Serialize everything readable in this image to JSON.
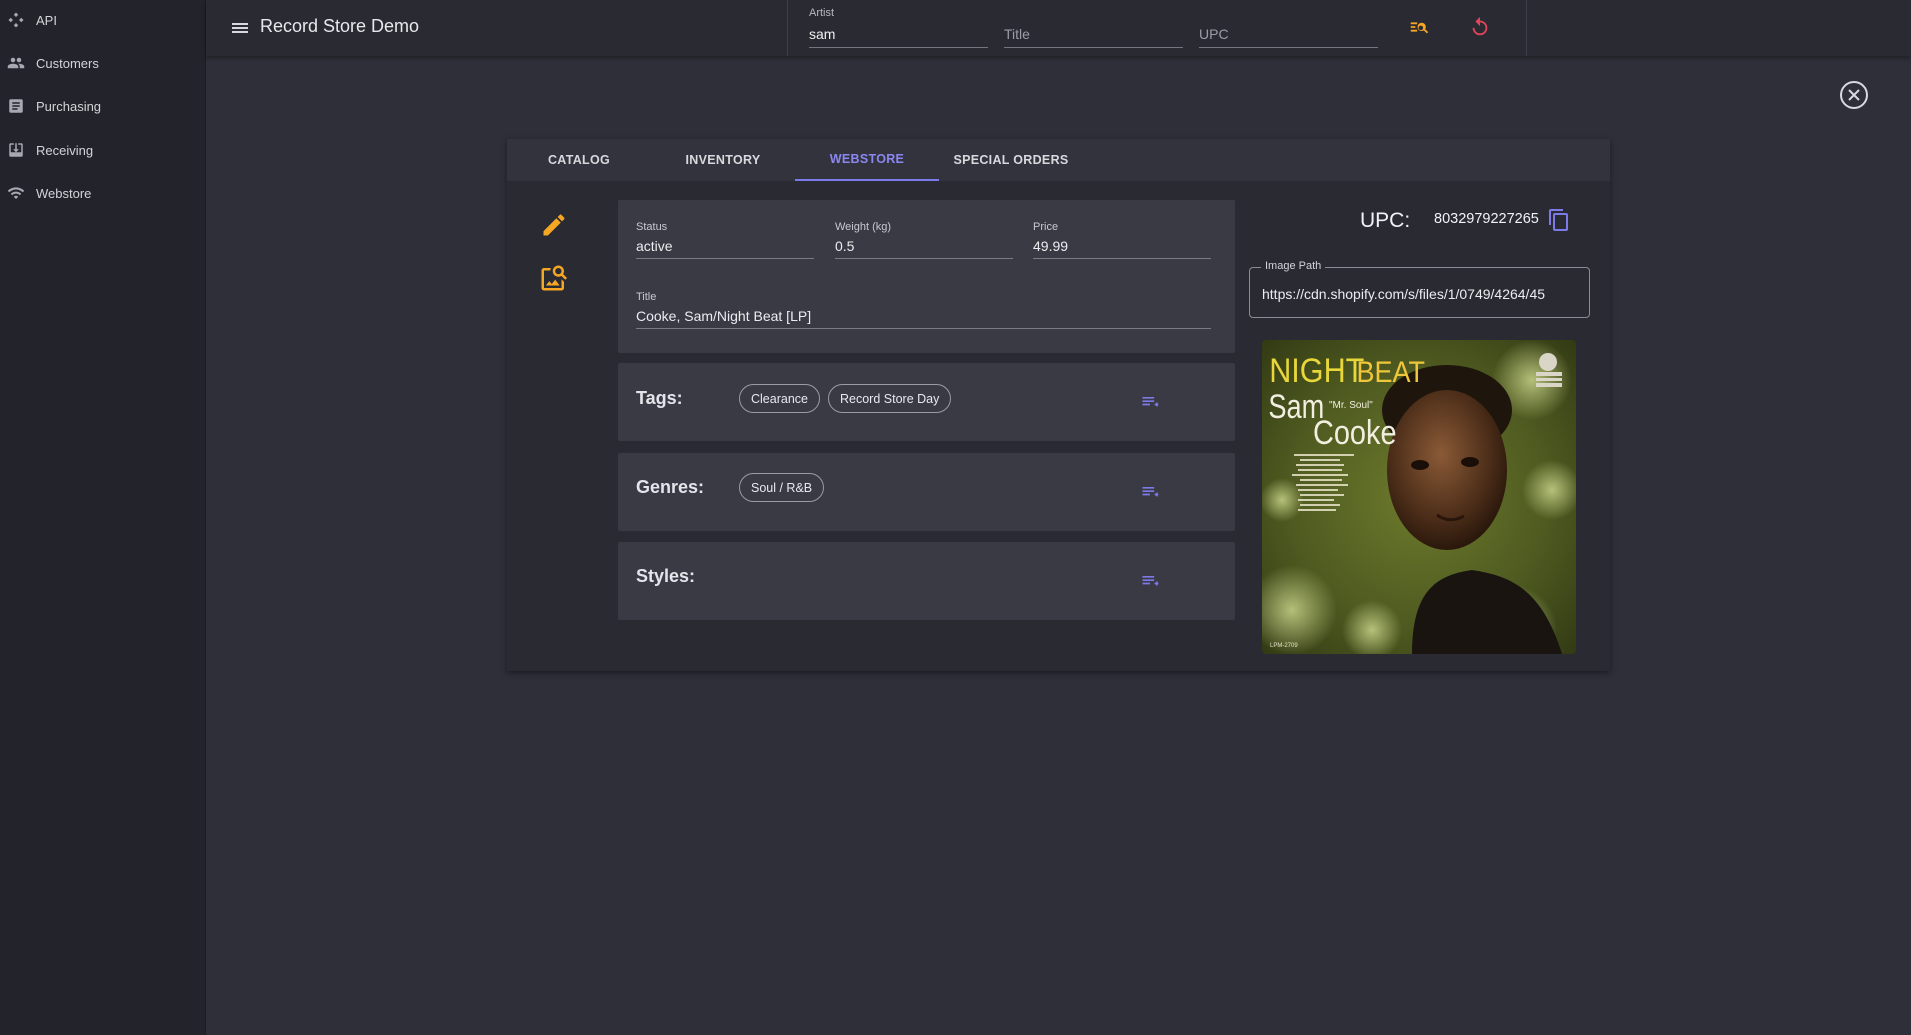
{
  "sidebar": {
    "items": [
      {
        "label": "API",
        "icon": "api-icon"
      },
      {
        "label": "Customers",
        "icon": "people-icon"
      },
      {
        "label": "Purchasing",
        "icon": "document-icon"
      },
      {
        "label": "Receiving",
        "icon": "download-box-icon"
      },
      {
        "label": "Webstore",
        "icon": "wifi-icon"
      }
    ]
  },
  "header": {
    "title": "Record Store Demo",
    "search": {
      "artist_label": "Artist",
      "artist_value": "sam",
      "title_placeholder": "Title",
      "upc_placeholder": "UPC"
    }
  },
  "tabs": [
    "CATALOG",
    "INVENTORY",
    "WEBSTORE",
    "SPECIAL ORDERS"
  ],
  "active_tab": "WEBSTORE",
  "details": {
    "status_label": "Status",
    "status_value": "active",
    "weight_label": "Weight (kg)",
    "weight_value": "0.5",
    "price_label": "Price",
    "price_value": "49.99",
    "title_label": "Title",
    "title_value": "Cooke, Sam/Night Beat [LP]"
  },
  "tags": {
    "label": "Tags:",
    "items": [
      "Clearance",
      "Record Store Day"
    ]
  },
  "genres": {
    "label": "Genres:",
    "items": [
      "Soul / R&B"
    ]
  },
  "styles": {
    "label": "Styles:",
    "items": []
  },
  "upc": {
    "label": "UPC:",
    "value": "8032979227265"
  },
  "image_path": {
    "label": "Image Path",
    "value": "https://cdn.shopify.com/s/files/1/0749/4264/45"
  },
  "album_art": {
    "night": "NIGHT",
    "beat": "BEAT",
    "sam": "Sam",
    "mr_soul": "\"Mr. Soul\"",
    "cooke": "Cooke",
    "catalog_no": "LPM-2709"
  },
  "colors": {
    "accent": "#7c79e8",
    "warning": "#f5a623",
    "reset": "#e0455a",
    "background": "#2f2f3a",
    "sidebar": "#23232b",
    "panel": "#3a3a45"
  }
}
